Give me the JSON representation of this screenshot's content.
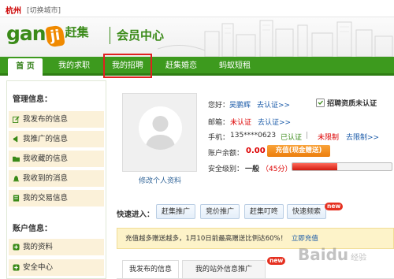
{
  "topbar": {
    "city": "杭州",
    "switch_city": "[切换城市]"
  },
  "header": {
    "logo_word": "gan",
    "logo_mark": "ji",
    "logo_brand": "赶集",
    "section_title": "会员中心"
  },
  "nav": {
    "items": [
      {
        "label": "首 页",
        "active": true
      },
      {
        "label": "我的求职"
      },
      {
        "label": "我的招聘"
      },
      {
        "label": "赶集婚恋"
      },
      {
        "label": "蚂蚁短租"
      }
    ]
  },
  "sidebar": {
    "manage_heading": "管理信息：",
    "manage_items": [
      "我发布的信息",
      "我推广的信息",
      "我收藏的信息",
      "我收到的消息",
      "我的交易信息"
    ],
    "account_heading": "账户信息：",
    "account_items": [
      "我的资料",
      "安全中心"
    ]
  },
  "profile": {
    "edit_link": "修改个人资料",
    "greeting_label": "您好：",
    "username": "吴鹏辉",
    "verify_link": "去认证>>",
    "recruit_badge": "招聘资质未认证",
    "email_label": "邮箱：",
    "email_status": "未认证",
    "email_link": "去认证>>",
    "phone_label": "手机：",
    "phone_value": "135****0623",
    "phone_status": "已认证",
    "phone_limit": "未限制",
    "phone_link": "去限制>>",
    "balance_label": "账户余额：",
    "balance_value": "0.00",
    "recharge_button": "充值(现金赠送)",
    "security_label": "安全级别：",
    "security_level": "一般",
    "security_score": "（45分）",
    "security_percent": 45
  },
  "quick": {
    "label": "快速进入：",
    "buttons": [
      "赶集推广",
      "竞价推广",
      "赶集叮咚",
      "快速频索"
    ],
    "new_badge": "new"
  },
  "notice": {
    "text": "充值越多赠送越多，1月10日前最高赠送比例达60%！",
    "link": "立即充值"
  },
  "tabs": {
    "items": [
      "我发布的信息",
      "我的站外信息推广"
    ],
    "new_badge": "new"
  },
  "watermark": {
    "text": "Baidu",
    "sub": "经验"
  },
  "colors": {
    "brand_green": "#3d9a1e",
    "accent_orange": "#ec7d0b",
    "alert_red": "#d00"
  }
}
